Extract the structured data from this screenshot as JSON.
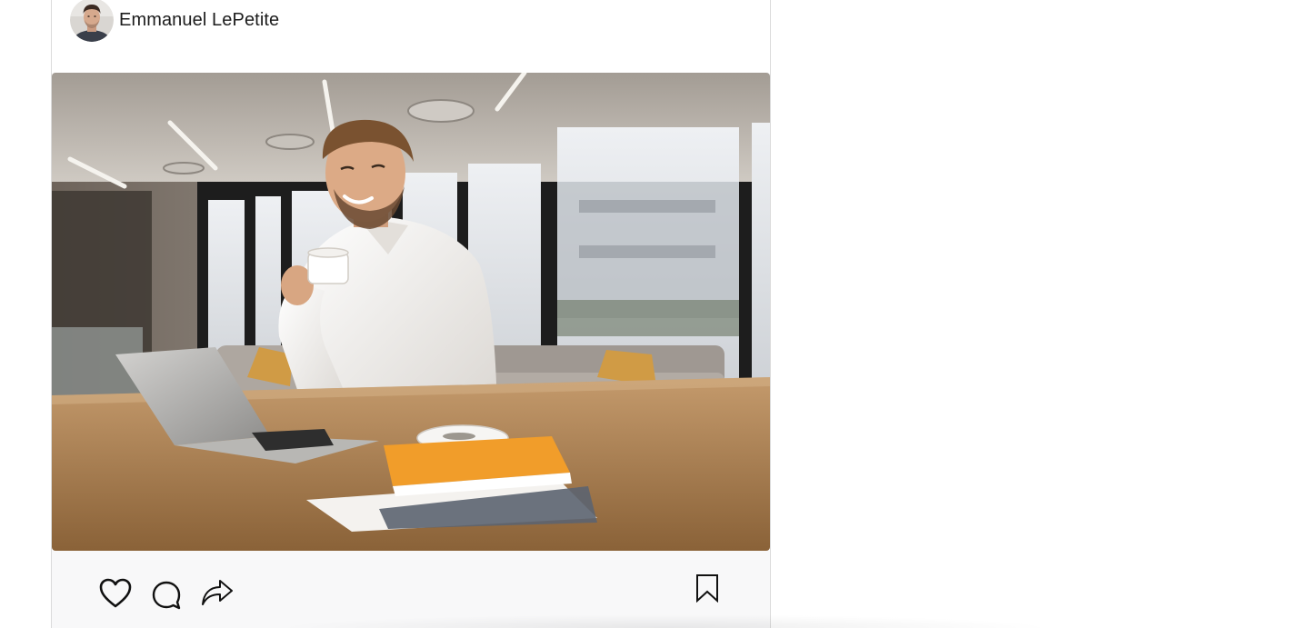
{
  "post": {
    "author": {
      "name": "Emmanuel LePetite",
      "avatar": "avatar-photo"
    },
    "image": {
      "subject": "photo-man-with-coffee-at-laptop"
    },
    "actions": {
      "like_icon": "heart-icon",
      "comment_icon": "comment-icon",
      "share_icon": "share-icon",
      "save_icon": "bookmark-icon"
    }
  },
  "colors": {
    "text": "#1c1c1c",
    "border": "#dbdbdb",
    "action_bar_bg": "#f8f8f9",
    "icon_stroke": "#111111"
  }
}
